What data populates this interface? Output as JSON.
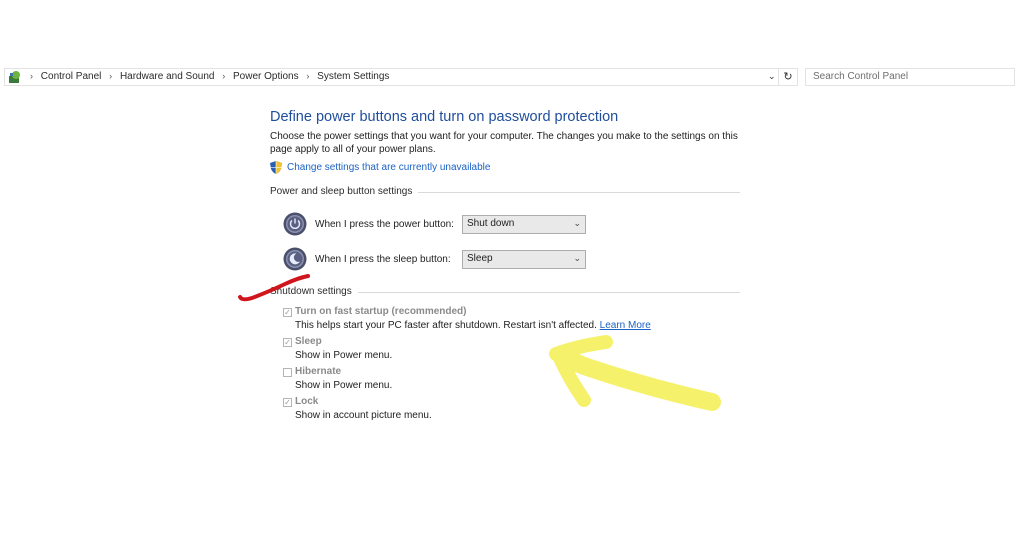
{
  "address_bar": {
    "icon": "control-panel-icon",
    "breadcrumbs": [
      "Control Panel",
      "Hardware and Sound",
      "Power Options",
      "System Settings"
    ],
    "separator": "›",
    "dropdown_glyph": "⌄",
    "refresh_glyph": "↻"
  },
  "search": {
    "placeholder": "Search Control Panel"
  },
  "page": {
    "title": "Define power buttons and turn on password protection",
    "description": "Choose the power settings that you want for your computer. The changes you make to the settings on this page apply to all of your power plans.",
    "change_settings_link": "Change settings that are currently unavailable"
  },
  "power_sleep_section": {
    "heading": "Power and sleep button settings",
    "power_button": {
      "label": "When I press the power button:",
      "value": "Shut down"
    },
    "sleep_button": {
      "label": "When I press the sleep button:",
      "value": "Sleep"
    }
  },
  "shutdown_section": {
    "heading": "Shutdown settings",
    "options": [
      {
        "label": "Turn on fast startup (recommended)",
        "checked": true,
        "desc": "This helps start your PC faster after shutdown. Restart isn't affected.",
        "link": "Learn More"
      },
      {
        "label": "Sleep",
        "checked": true,
        "desc": "Show in Power menu."
      },
      {
        "label": "Hibernate",
        "checked": false,
        "desc": "Show in Power menu."
      },
      {
        "label": "Lock",
        "checked": true,
        "desc": "Show in account picture menu."
      }
    ]
  },
  "annotations": {
    "red_mark_color": "#d0161c",
    "yellow_arrow_color": "#f5f05a"
  },
  "colors": {
    "title_blue": "#1f4e9c",
    "link_blue": "#1a62c5"
  }
}
